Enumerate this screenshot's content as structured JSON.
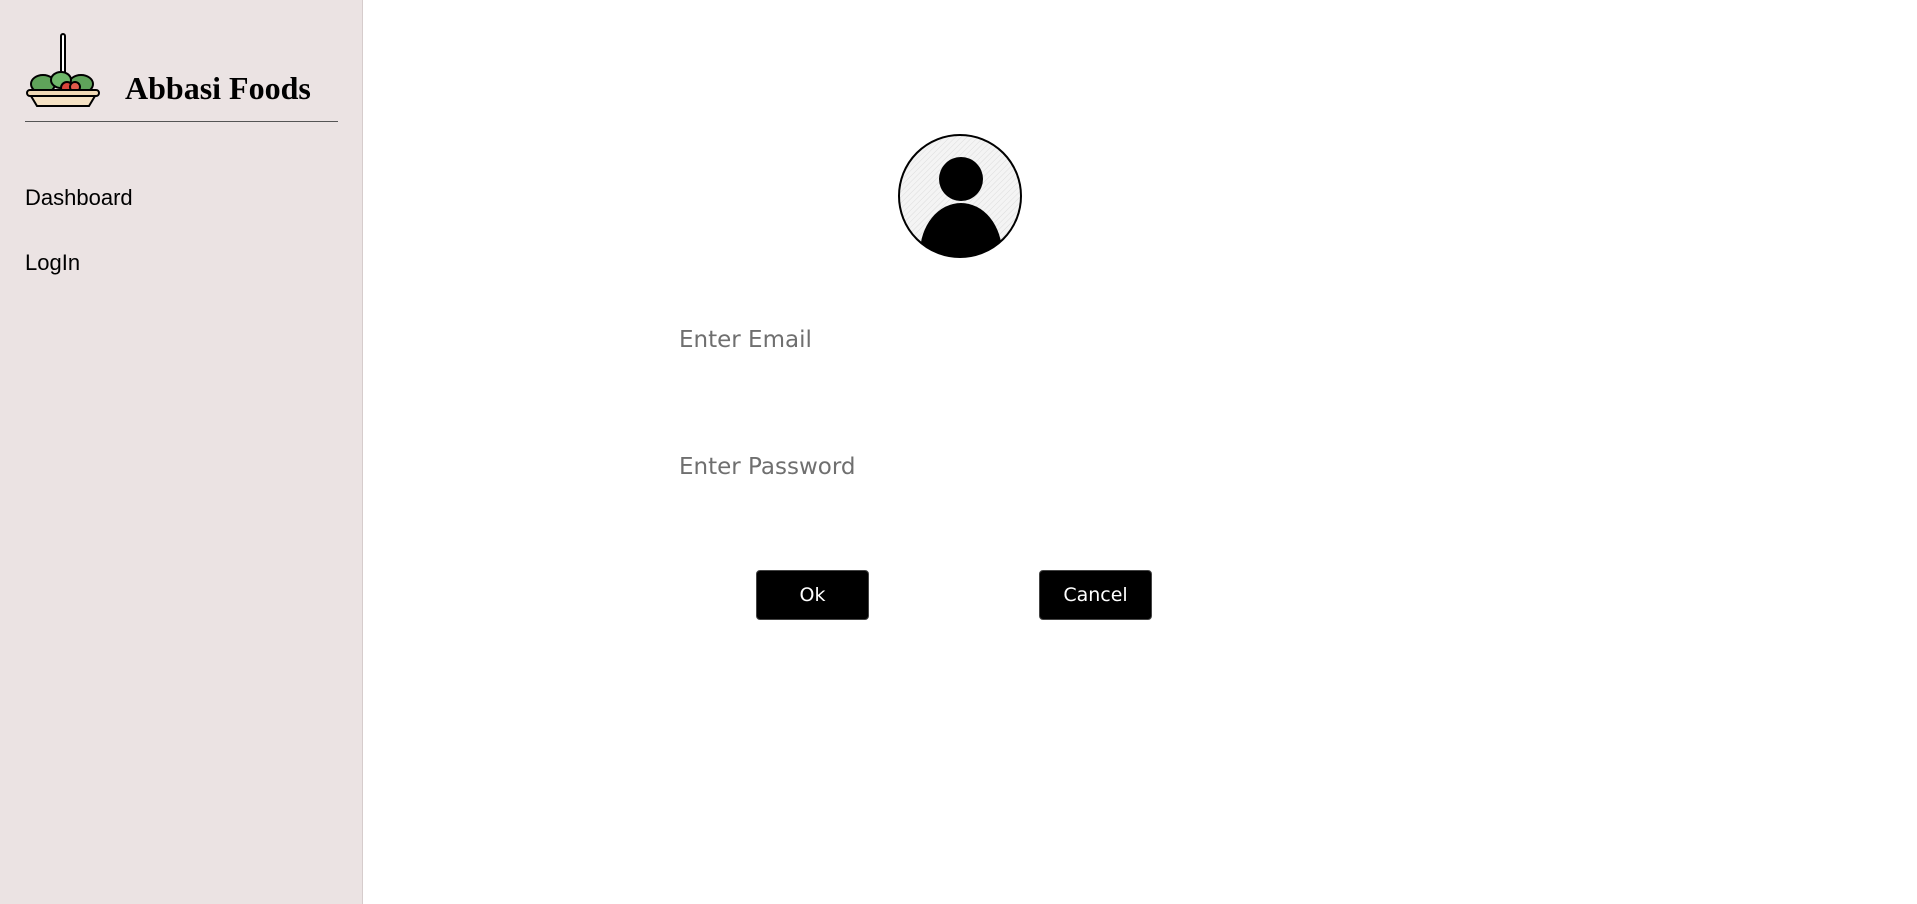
{
  "sidebar": {
    "brand": {
      "title": "Abbasi Foods",
      "logo_icon": "salad-plate-icon"
    },
    "nav": [
      {
        "label": "Dashboard"
      },
      {
        "label": "LogIn"
      }
    ]
  },
  "login": {
    "avatar_icon": "user-avatar-icon",
    "email": {
      "placeholder": "Enter Email",
      "value": ""
    },
    "password": {
      "placeholder": "Enter Password",
      "value": ""
    },
    "ok_label": "Ok",
    "cancel_label": "Cancel"
  },
  "colors": {
    "sidebar_bg": "#ebe3e3",
    "button_bg": "#000000",
    "button_text": "#ffffff",
    "placeholder": "#6f6f6f"
  }
}
